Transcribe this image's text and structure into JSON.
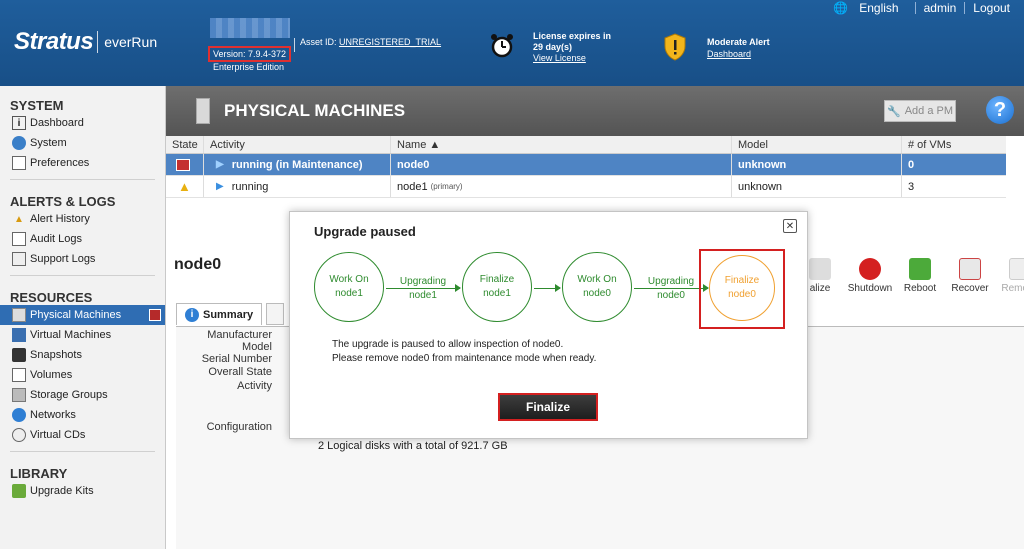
{
  "header": {
    "brand": "Stratus",
    "product": "everRun",
    "version": "Version: 7.9.4-372",
    "edition": "Enterprise Edition",
    "asset_label": "Asset ID:",
    "asset_value": "UNREGISTERED_TRIAL",
    "license_line1": "License expires in",
    "license_line2": "29 day(s)",
    "license_link": "View License",
    "alert_title": "Moderate Alert",
    "alert_link": "Dashboard",
    "language": "English",
    "user": "admin",
    "logout": "Logout"
  },
  "sidebar": {
    "system_title": "SYSTEM",
    "system_items": [
      "Dashboard",
      "System",
      "Preferences"
    ],
    "alerts_title": "ALERTS & LOGS",
    "alerts_items": [
      "Alert History",
      "Audit Logs",
      "Support Logs"
    ],
    "resources_title": "RESOURCES",
    "resources_items": [
      "Physical Machines",
      "Virtual Machines",
      "Snapshots",
      "Volumes",
      "Storage Groups",
      "Networks",
      "Virtual CDs"
    ],
    "library_title": "LIBRARY",
    "library_items": [
      "Upgrade Kits"
    ]
  },
  "main": {
    "title": "PHYSICAL MACHINES",
    "add_pm": "Add a PM",
    "help": "?",
    "columns": [
      "State",
      "Activity",
      "Name ▲",
      "Model",
      "# of VMs"
    ],
    "rows": [
      {
        "activity": "running (in Maintenance)",
        "name": "node0",
        "role": "",
        "model": "unknown",
        "vms": "0"
      },
      {
        "activity": "running",
        "name": "node1",
        "role": "(primary)",
        "model": "unknown",
        "vms": "3"
      }
    ],
    "node_title": "node0",
    "actions": [
      "alize",
      "Shutdown",
      "Reboot",
      "Recover",
      "Remove"
    ],
    "tab_summary": "Summary",
    "details_labels": [
      "Manufacturer",
      "Model",
      "Serial Number",
      "Overall State",
      "Activity",
      "Configuration"
    ],
    "disks_text": "2 Logical disks with a total of 921.7 GB"
  },
  "dialog": {
    "title": "Upgrade paused",
    "close": "✕",
    "steps": [
      {
        "line1": "Work On",
        "line2": "node1"
      },
      {
        "line1": "Finalize",
        "line2": "node1"
      },
      {
        "line1": "Work On",
        "line2": "node0"
      },
      {
        "line1": "Finalize",
        "line2": "node0"
      }
    ],
    "connectors": [
      {
        "line1": "Upgrading",
        "line2": "node1"
      },
      {
        "line1": "Upgrading",
        "line2": "node0"
      }
    ],
    "message_line1": "The upgrade is paused to allow inspection of node0.",
    "message_line2": "Please remove node0 from maintenance mode when ready.",
    "button": "Finalize"
  },
  "colors": {
    "header_blue": "#1f5e9c",
    "selected_row": "#4e84c4",
    "step_green": "#2e8b2e",
    "step_current": "#f0a030",
    "highlight_red": "#d42020"
  }
}
